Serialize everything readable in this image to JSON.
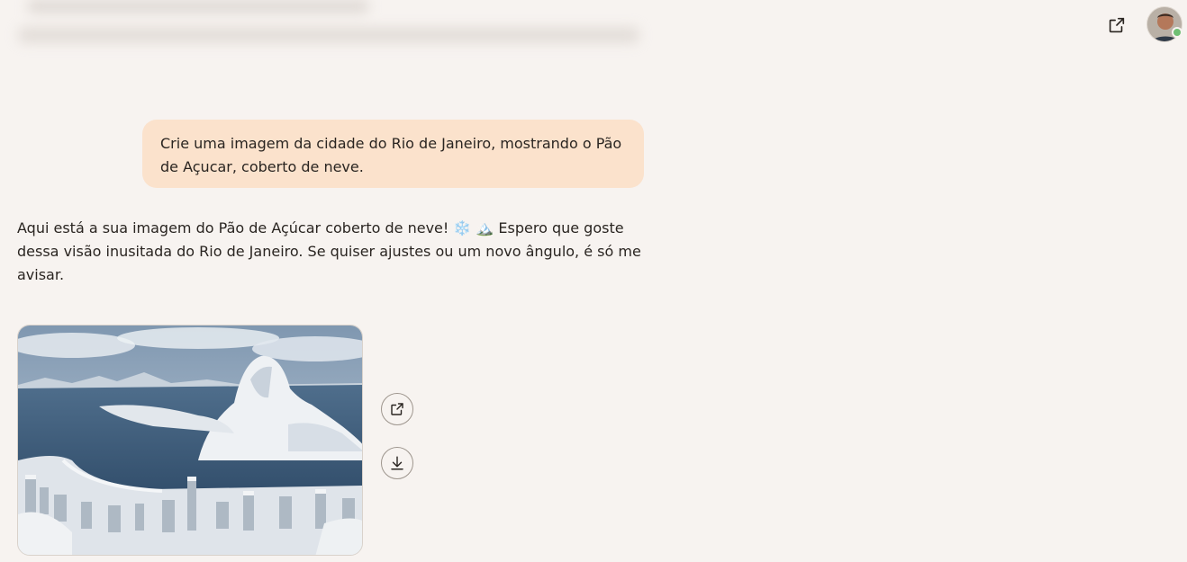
{
  "header": {
    "share_icon": "share-icon",
    "avatar_icon": "user-avatar"
  },
  "conversation": {
    "user_message": "Crie uma imagem da cidade do Rio de Janeiro, mostrando o Pão de Açucar, coberto de neve.",
    "assistant_reply": "Aqui está a sua imagem do Pão de Açúcar coberto de neve! ❄️ 🏔️ Espero que goste dessa visão inusitada do Rio de Janeiro. Se quiser ajustes ou um novo ângulo, é só me avisar.",
    "image_actions": {
      "share_icon": "share-icon",
      "download_icon": "download-icon"
    }
  },
  "colors": {
    "background": "#f7f3f0",
    "user_bubble": "#fbe2cc",
    "text": "#2a2521"
  }
}
